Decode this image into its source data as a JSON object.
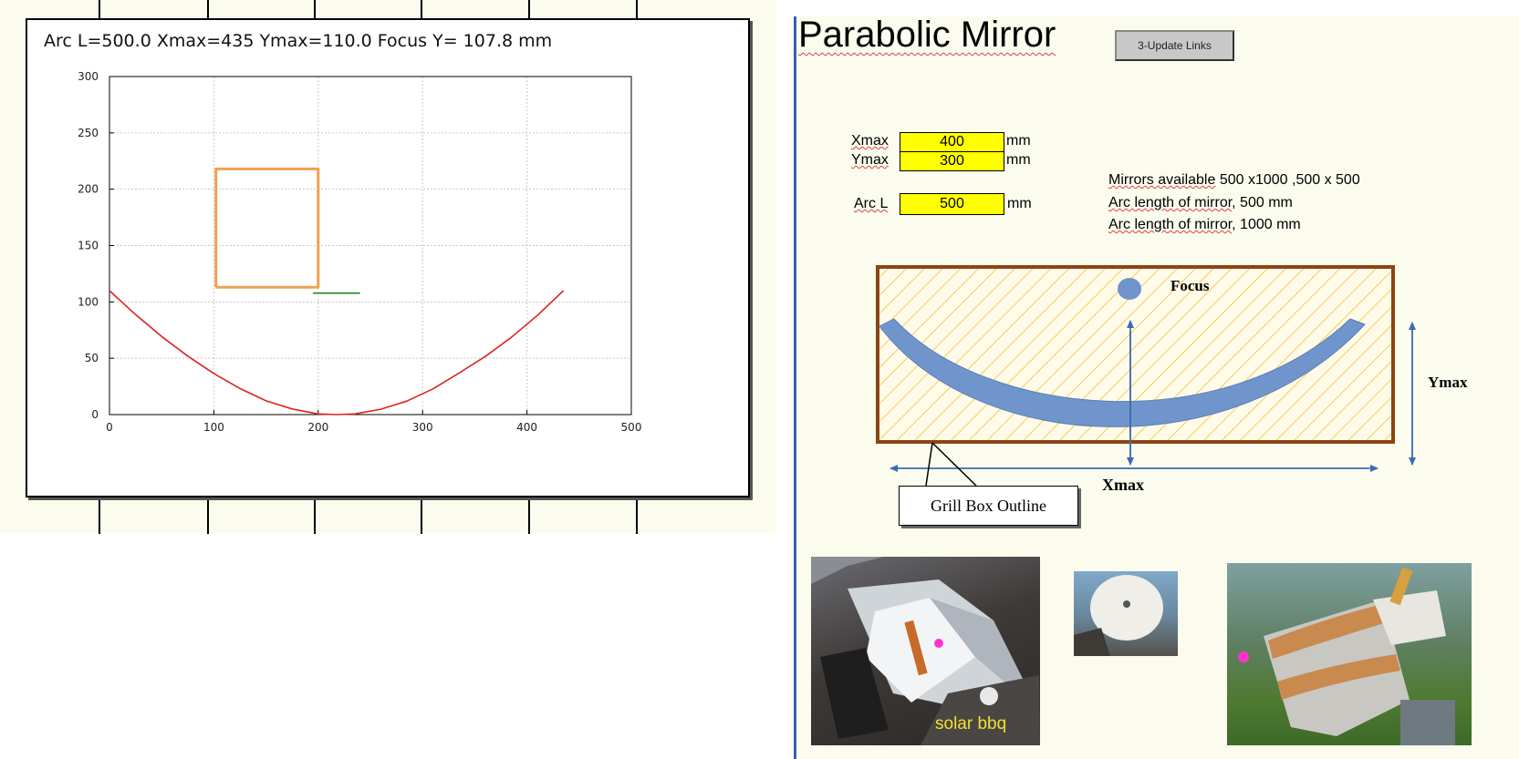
{
  "chart": {
    "title": "Arc L=500.0 Xmax=435 Ymax=110.0 Focus Y= 107.8 mm"
  },
  "chart_data": {
    "type": "line",
    "title": "Arc L=500.0 Xmax=435 Ymax=110.0 Focus Y= 107.8 mm",
    "xlabel": "",
    "ylabel": "",
    "xlim": [
      0,
      500
    ],
    "ylim": [
      0,
      300
    ],
    "x_ticks": [
      0,
      100,
      200,
      300,
      400,
      500
    ],
    "y_ticks": [
      0,
      50,
      100,
      150,
      200,
      250,
      300
    ],
    "grid": true,
    "series": [
      {
        "color": "#dd2222",
        "x": [
          0,
          25,
          50,
          75,
          100,
          125,
          150,
          175,
          200,
          217.5,
          235,
          260,
          285,
          310,
          335,
          360,
          385,
          410,
          435
        ],
        "y": [
          110,
          88.7,
          69.3,
          51.9,
          36.5,
          23.1,
          12.2,
          5.0,
          0.6,
          0,
          0.6,
          4.8,
          12.0,
          22.8,
          36.9,
          51.5,
          68.5,
          88.0,
          110
        ]
      },
      {
        "color": "#1a8a1a",
        "x": [
          195,
          240
        ],
        "y": [
          107.8,
          107.8
        ]
      },
      {
        "color": "#f0a050",
        "x": [
          102,
          200,
          200,
          102,
          102
        ],
        "y": [
          113,
          113,
          218,
          218,
          113
        ]
      }
    ]
  },
  "header": {
    "title": "Parabolic Mirror",
    "update_button": "3-Update Links"
  },
  "inputs": {
    "xmax": {
      "label": "Xmax",
      "value": "400",
      "unit": "mm"
    },
    "ymax": {
      "label": "Ymax",
      "value": "300",
      "unit": "mm"
    },
    "arc": {
      "label": "Arc L",
      "value": "500",
      "unit": "mm"
    }
  },
  "notes": {
    "mirrors": {
      "prefix": "Mirrors available",
      "suffix": " 500 x1000 ,500 x 500"
    },
    "arc500": {
      "prefix": "Arc length of mirror",
      "suffix": ", 500  mm"
    },
    "arc1000": {
      "prefix": "Arc length of mirror",
      "suffix": ", 1000 mm"
    }
  },
  "diagram": {
    "focus": "Focus",
    "ymax": "Ymax",
    "xmax": "Xmax",
    "callout": "Grill Box Outline"
  },
  "photos": {
    "caption1": "solar bbq"
  },
  "colors": {
    "divider": "#3b5ea8",
    "field_fill": "#ffff00",
    "mirror_blue": "#6f95cc",
    "box_brown": "#8b4513",
    "hatch": "#f0c040"
  }
}
